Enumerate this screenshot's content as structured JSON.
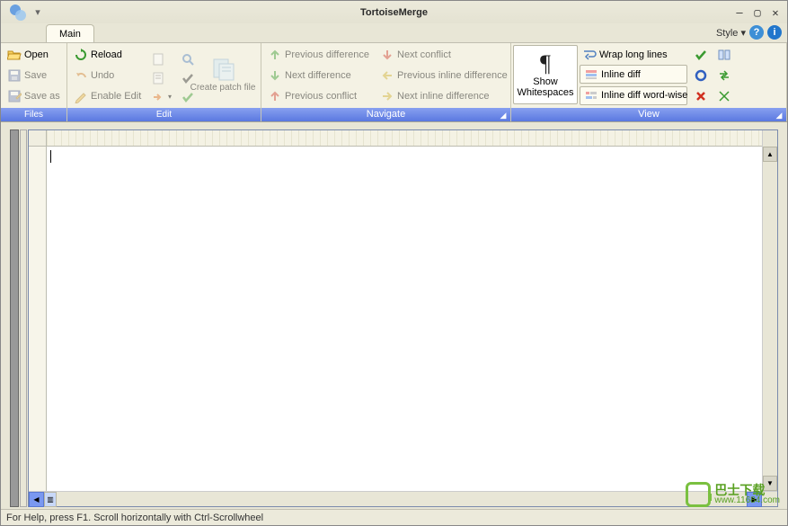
{
  "title": "TortoiseMerge",
  "tab": {
    "main": "Main"
  },
  "style_menu": "Style",
  "ribbon": {
    "files": {
      "label": "Files",
      "open": "Open",
      "save": "Save",
      "saveas": "Save as"
    },
    "edit": {
      "label": "Edit",
      "reload": "Reload",
      "undo": "Undo",
      "enable_edit": "Enable Edit",
      "create_patch": "Create patch file"
    },
    "navigate": {
      "label": "Navigate",
      "prev_diff": "Previous difference",
      "next_diff": "Next difference",
      "prev_conflict": "Previous conflict",
      "next_conflict": "Next conflict",
      "prev_inline": "Previous inline difference",
      "next_inline": "Next inline difference"
    },
    "view": {
      "label": "View",
      "show_ws_line1": "Show",
      "show_ws_line2": "Whitespaces",
      "wrap": "Wrap long lines",
      "inline_diff": "Inline diff",
      "inline_word": "Inline diff word-wise"
    }
  },
  "status": "For Help, press F1. Scroll horizontally with Ctrl-Scrollwheel",
  "watermark": {
    "cn": "巴士下载",
    "url": "www.11684.com"
  }
}
